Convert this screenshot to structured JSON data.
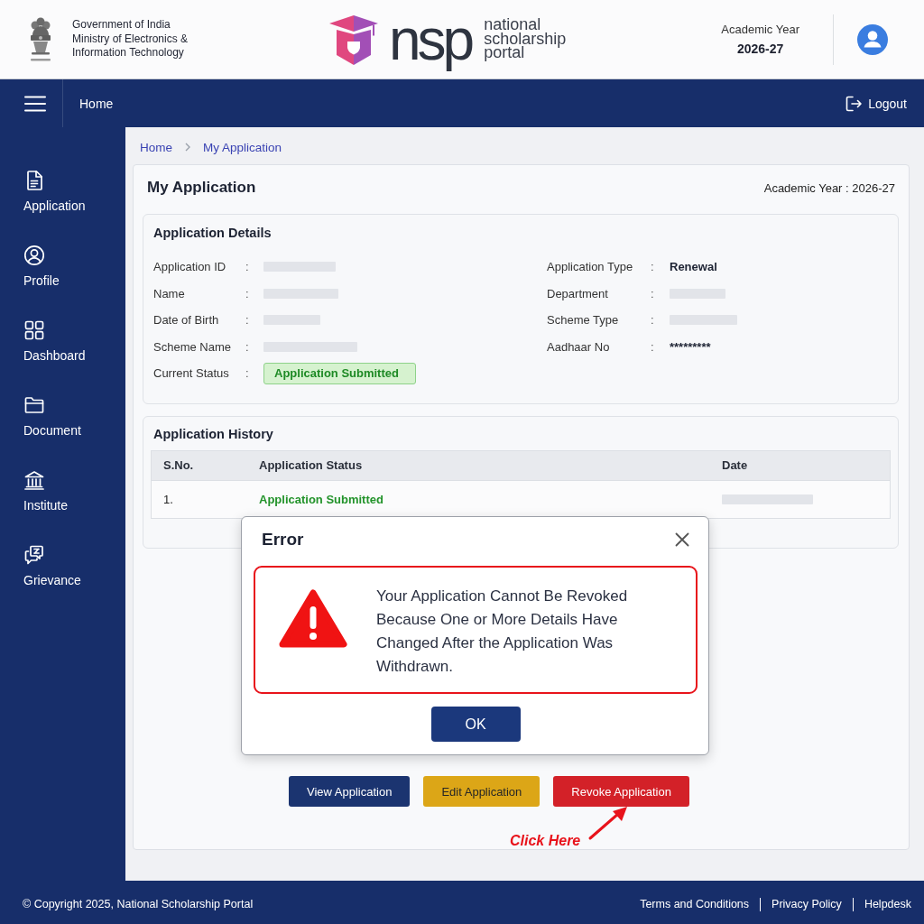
{
  "header": {
    "org_lines": [
      "Government of India",
      "Ministry of Electronics &",
      "Information Technology"
    ],
    "logo_mark": "nsp",
    "logo_text": "national scholarship portal",
    "academic_year_label": "Academic Year",
    "academic_year": "2026-27"
  },
  "nav": {
    "home": "Home",
    "logout": "Logout"
  },
  "sidebar": {
    "items": [
      {
        "label": "Application",
        "kind": "document"
      },
      {
        "label": "Profile",
        "kind": "user"
      },
      {
        "label": "Dashboard",
        "kind": "grid"
      },
      {
        "label": "Document",
        "kind": "folder"
      },
      {
        "label": "Institute",
        "kind": "building"
      },
      {
        "label": "Grievance",
        "kind": "chat"
      }
    ]
  },
  "breadcrumb": [
    {
      "label": "Home"
    },
    {
      "label": "My Application"
    }
  ],
  "page": {
    "title": "My Application",
    "academic_year": "Academic Year : 2026-27"
  },
  "details": {
    "title": "Application Details",
    "fields": [
      {
        "label": "Application ID",
        "sep": ":",
        "kind": "redacted"
      },
      {
        "label": "Application Type",
        "sep": ":",
        "kind": "text",
        "value": "Renewal"
      },
      {
        "label": "Name",
        "sep": ":",
        "kind": "redacted"
      },
      {
        "label": "Department",
        "sep": ":",
        "kind": "redacted"
      },
      {
        "label": "Date of Birth",
        "sep": ":",
        "kind": "redacted"
      },
      {
        "label": "Scheme Type",
        "sep": ":",
        "kind": "redacted"
      },
      {
        "label": "Scheme Name",
        "sep": ":",
        "kind": "redacted"
      },
      {
        "label": "Aadhaar No",
        "sep": ":",
        "kind": "text",
        "value": "*********"
      },
      {
        "label": "Current Status",
        "sep": ":",
        "kind": "status",
        "value": "Application Submitted"
      }
    ]
  },
  "history": {
    "title": "Application History",
    "columns": [
      "S.No.",
      "Application Status",
      "Date"
    ],
    "rows": [
      {
        "cells": [
          {
            "kind": "text",
            "value": "1."
          },
          {
            "kind": "status",
            "value": "Application Submitted"
          },
          {
            "kind": "redacted"
          }
        ]
      }
    ]
  },
  "dialog": {
    "title": "Error",
    "message": "Your Application Cannot Be Revoked Because One or More Details Have Changed After the Application Was Withdrawn.",
    "button": "OK"
  },
  "actions": [
    {
      "label": "View Application",
      "kind": "primary"
    },
    {
      "label": "Edit Application",
      "kind": "warning"
    },
    {
      "label": "Revoke Application",
      "kind": "danger"
    }
  ],
  "annotation": {
    "text": "Click Here"
  },
  "footer": {
    "copyright": "© Copyright 2025, National Scholarship Portal",
    "links": [
      "Terms and Conditions",
      "Privacy Policy",
      "Helpdesk"
    ]
  }
}
